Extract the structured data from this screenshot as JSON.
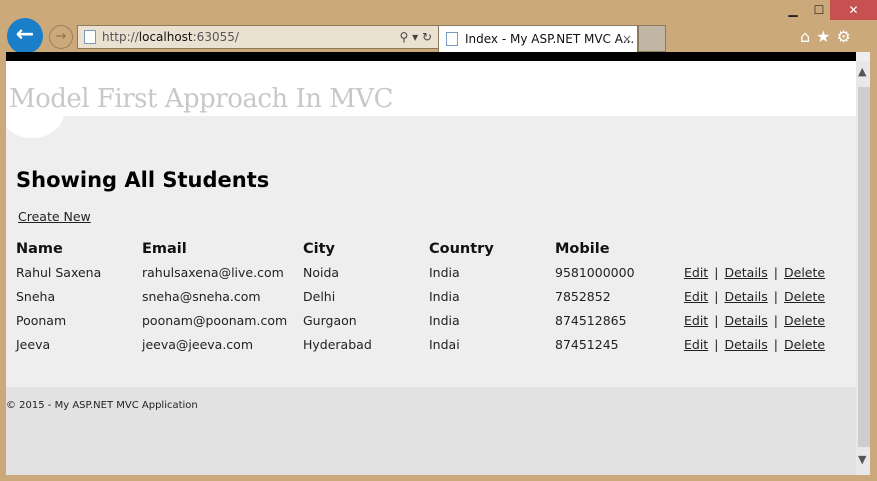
{
  "browser": {
    "url_prefix": "http://",
    "url_host": "localhost",
    "url_port": ":63055/",
    "tab_title": "Index - My ASP.NET MVC A...",
    "tab_close": "×"
  },
  "site": {
    "title": "Model First Approach In MVC"
  },
  "main": {
    "heading": "Showing All Students",
    "create_link": "Create New",
    "columns": [
      "Name",
      "Email",
      "City",
      "Country",
      "Mobile"
    ],
    "rows": [
      {
        "name": "Rahul Saxena",
        "email": "rahulsaxena@live.com",
        "city": "Noida",
        "country": "India",
        "mobile": "9581000000"
      },
      {
        "name": "Sneha",
        "email": "sneha@sneha.com",
        "city": "Delhi",
        "country": "India",
        "mobile": "7852852"
      },
      {
        "name": "Poonam",
        "email": "poonam@poonam.com",
        "city": "Gurgaon",
        "country": "India",
        "mobile": "874512865"
      },
      {
        "name": "Jeeva",
        "email": "jeeva@jeeva.com",
        "city": "Hyderabad",
        "country": "Indai",
        "mobile": "87451245"
      }
    ],
    "actions": {
      "edit": "Edit",
      "details": "Details",
      "delete": "Delete",
      "sep": "|"
    }
  },
  "footer": {
    "text": "© 2015 - My ASP.NET MVC Application"
  }
}
